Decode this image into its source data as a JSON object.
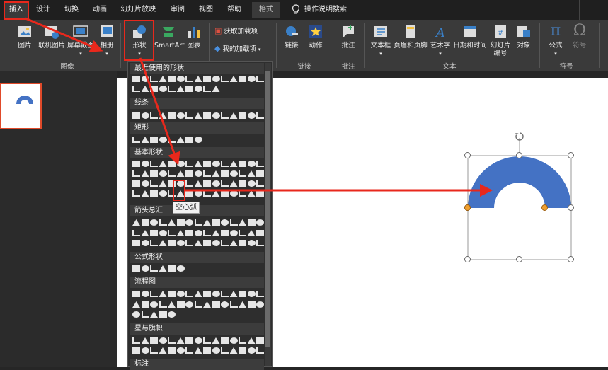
{
  "tabs": {
    "insert": "插入",
    "design": "设计",
    "transitions": "切换",
    "animations": "动画",
    "slideshow": "幻灯片放映",
    "review": "审阅",
    "view": "视图",
    "help": "帮助",
    "format": "格式",
    "tell_me": "操作说明搜索"
  },
  "ribbon": {
    "picture": "图片",
    "online_picture": "联机图片",
    "screenshot": "屏幕截图",
    "album": "相册",
    "shapes": "形状",
    "smartart": "SmartArt",
    "chart": "图表",
    "get_addins": "获取加载项",
    "my_addins": "我的加载项",
    "link": "链接",
    "action": "动作",
    "comment": "批注",
    "textbox": "文本框",
    "header_footer": "页眉和页脚",
    "wordart": "艺术字",
    "datetime": "日期和时间",
    "slide_number": "幻灯片编号",
    "object": "对象",
    "equation": "公式",
    "symbol": "符号",
    "group_images": "图像",
    "group_links": "链接",
    "group_comments": "批注",
    "group_text": "文本",
    "group_symbols": "符号"
  },
  "shapes_menu": {
    "recent": "最近使用的形状",
    "lines": "线条",
    "rectangles": "矩形",
    "basic": "基本形状",
    "arrows": "箭头总汇",
    "equation": "公式形状",
    "flowchart": "流程图",
    "stars": "星与旗帜",
    "callouts": "标注"
  },
  "tooltip": "空心弧",
  "colors": {
    "accent": "#4472c4",
    "highlight": "#e8281c",
    "handle": "#f0a030"
  }
}
